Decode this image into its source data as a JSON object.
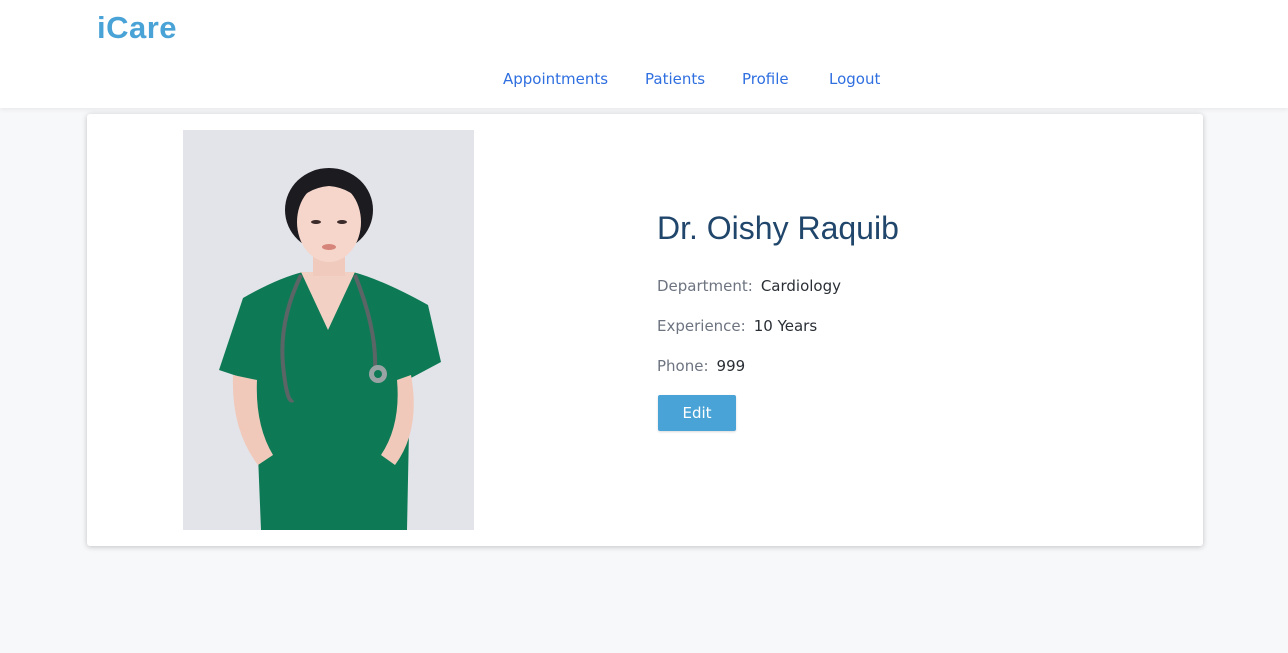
{
  "header": {
    "brand": "iCare",
    "nav": [
      {
        "label": "Appointments"
      },
      {
        "label": "Patients"
      },
      {
        "label": "Profile"
      },
      {
        "label": "Logout"
      }
    ]
  },
  "profile": {
    "name": "Dr. Oishy Raquib",
    "department_label": "Department:",
    "department": "Cardiology",
    "experience_label": "Experience:",
    "experience": "10 Years",
    "phone_label": "Phone:",
    "phone": "999",
    "edit_label": "Edit"
  },
  "colors": {
    "brand": "#4aa3d6",
    "nav_link": "#2f6fe0",
    "name": "#21466b",
    "button": "#4aa3d6",
    "scrubs": "#0e7a55"
  }
}
